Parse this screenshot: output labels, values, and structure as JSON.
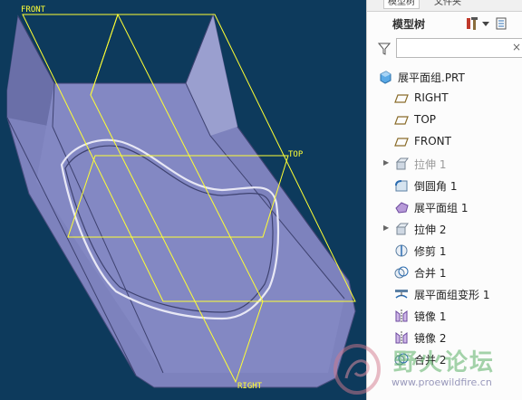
{
  "viewport": {
    "planes": {
      "front": "FRONT",
      "top": "TOP",
      "right": "RIGHT"
    },
    "colors": {
      "background": "#0d3a5c",
      "part": "#7d82bd",
      "plane": "#ffff33"
    }
  },
  "panel": {
    "tabs": [
      "模型树",
      "文件夹"
    ],
    "tree_title": "模型树",
    "filter_placeholder": "",
    "filter_clear": "×",
    "tree": [
      {
        "label": "展平面组.PRT",
        "icon": "part-icon",
        "expandable": false,
        "dim": false,
        "indent": 0
      },
      {
        "label": "RIGHT",
        "icon": "datum-plane-icon",
        "expandable": false,
        "dim": false,
        "indent": 1
      },
      {
        "label": "TOP",
        "icon": "datum-plane-icon",
        "expandable": false,
        "dim": false,
        "indent": 1
      },
      {
        "label": "FRONT",
        "icon": "datum-plane-icon",
        "expandable": false,
        "dim": false,
        "indent": 1
      },
      {
        "label": "拉伸 1",
        "icon": "extrude-icon",
        "expandable": true,
        "dim": true,
        "indent": 1
      },
      {
        "label": "倒圆角 1",
        "icon": "round-icon",
        "expandable": false,
        "dim": false,
        "indent": 1
      },
      {
        "label": "展平面组 1",
        "icon": "flatten-quilt-icon",
        "expandable": false,
        "dim": false,
        "indent": 1
      },
      {
        "label": "拉伸 2",
        "icon": "extrude-icon",
        "expandable": true,
        "dim": false,
        "indent": 1
      },
      {
        "label": "修剪 1",
        "icon": "trim-icon",
        "expandable": false,
        "dim": false,
        "indent": 1
      },
      {
        "label": "合并 1",
        "icon": "merge-icon",
        "expandable": false,
        "dim": false,
        "indent": 1
      },
      {
        "label": "展平面组变形 1",
        "icon": "flatten-deform-icon",
        "expandable": false,
        "dim": false,
        "indent": 1
      },
      {
        "label": "镜像 1",
        "icon": "mirror-icon",
        "expandable": false,
        "dim": false,
        "indent": 1
      },
      {
        "label": "镜像 2",
        "icon": "mirror-icon",
        "expandable": false,
        "dim": false,
        "indent": 1
      },
      {
        "label": "合并 2",
        "icon": "merge-icon",
        "expandable": false,
        "dim": false,
        "indent": 1
      }
    ]
  },
  "watermark": {
    "text": "野火论坛",
    "url": "www.proewildfire.cn"
  }
}
